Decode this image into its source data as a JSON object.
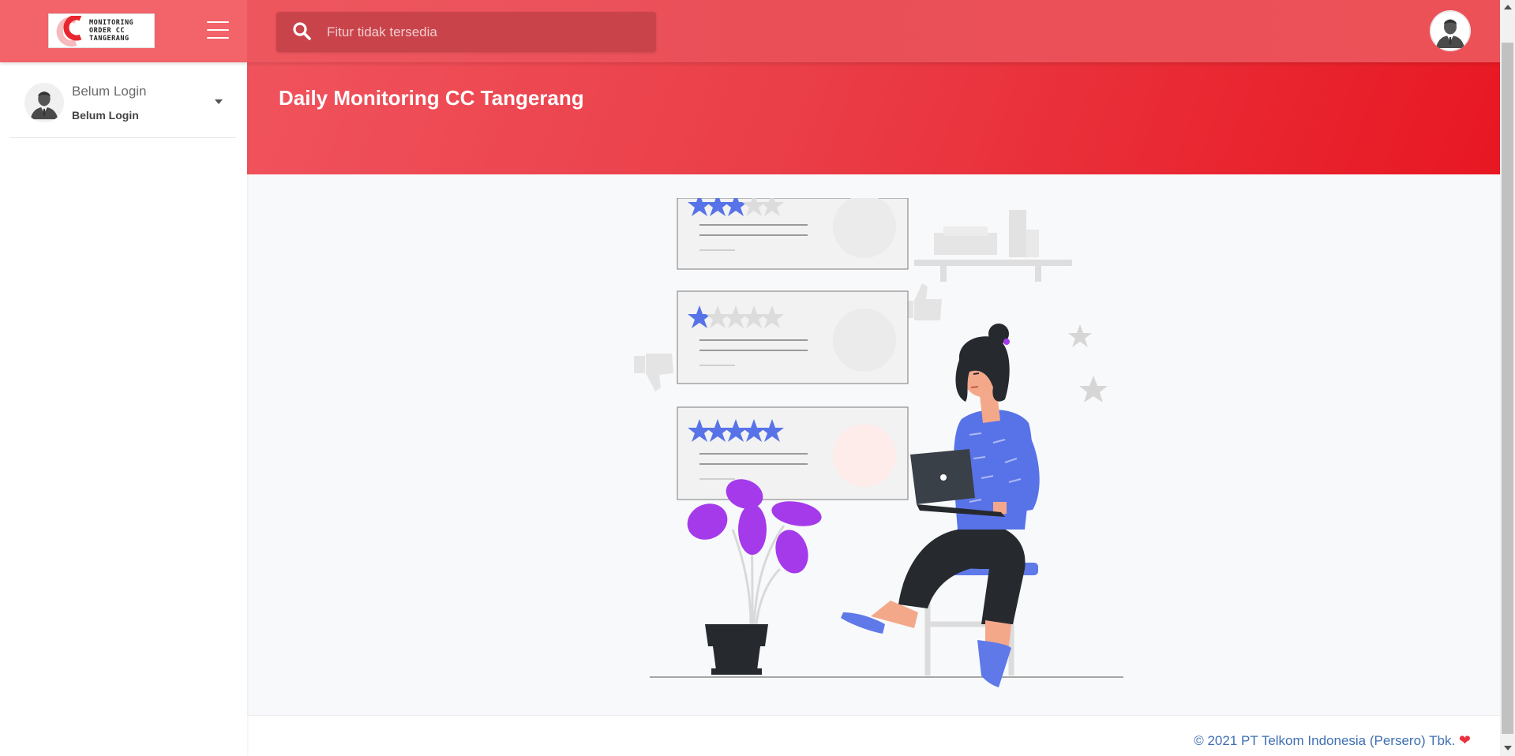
{
  "navbar": {
    "logo_text": "MONITORING\nORDER CC\nTANGERANG",
    "search_placeholder": "Fitur tidak tersedia",
    "accent_color": "#ea4f58"
  },
  "sidebar": {
    "user_name": "Belum Login",
    "user_status": "Belum Login"
  },
  "header": {
    "title": "Daily Monitoring CC Tangerang",
    "gradient_end": "#e81722"
  },
  "footer": {
    "copyright": "© 2021 PT Telkom Indonesia (Persero) Tbk."
  },
  "illustration": {
    "review_cards": [
      {
        "stars": 3
      },
      {
        "stars": 1
      },
      {
        "stars": 5
      }
    ]
  }
}
